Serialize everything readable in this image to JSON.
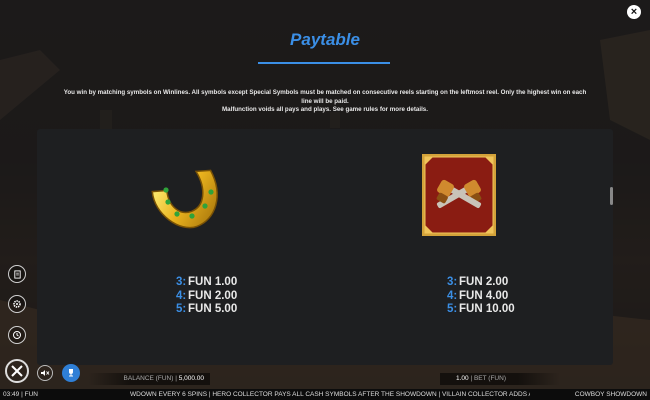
{
  "header": {
    "title": "Paytable",
    "close_icon": "×"
  },
  "rules": {
    "line1": "You win by matching symbols on Winlines. All symbols except Special Symbols must be matched on consecutive reels starting on the leftmost reel. Only the highest win on each line will be paid.",
    "line2": "Malfunction voids all pays and plays. See game rules for more details."
  },
  "symbols": [
    {
      "icon": "horseshoe-icon",
      "pays": [
        {
          "count": "3:",
          "value": "FUN 1.00"
        },
        {
          "count": "4:",
          "value": "FUN 2.00"
        },
        {
          "count": "5:",
          "value": "FUN 5.00"
        }
      ]
    },
    {
      "icon": "crossed-pistols-icon",
      "pays": [
        {
          "count": "3:",
          "value": "FUN 2.00"
        },
        {
          "count": "4:",
          "value": "FUN 4.00"
        },
        {
          "count": "5:",
          "value": "FUN 10.00"
        }
      ]
    }
  ],
  "controls": {
    "balance_label": "BALANCE (FUN)",
    "balance_value": "5,000.00",
    "bet_value": "1.00",
    "bet_label": "BET (FUN)"
  },
  "footer": {
    "time": "03:49",
    "currency": "FUN",
    "ticker": "WDOWN EVERY 6 SPINS | HERO COLLECTOR PAYS ALL CASH SYMBOLS AFTER THE SHOWDOWN | VILLAIN COLLECTOR ADDS ALL CASH SYMBOLS TO T",
    "game_name": "COWBOY SHOWDOWN"
  },
  "colors": {
    "accent": "#3b8fe6",
    "panel": "#1e1f21"
  }
}
